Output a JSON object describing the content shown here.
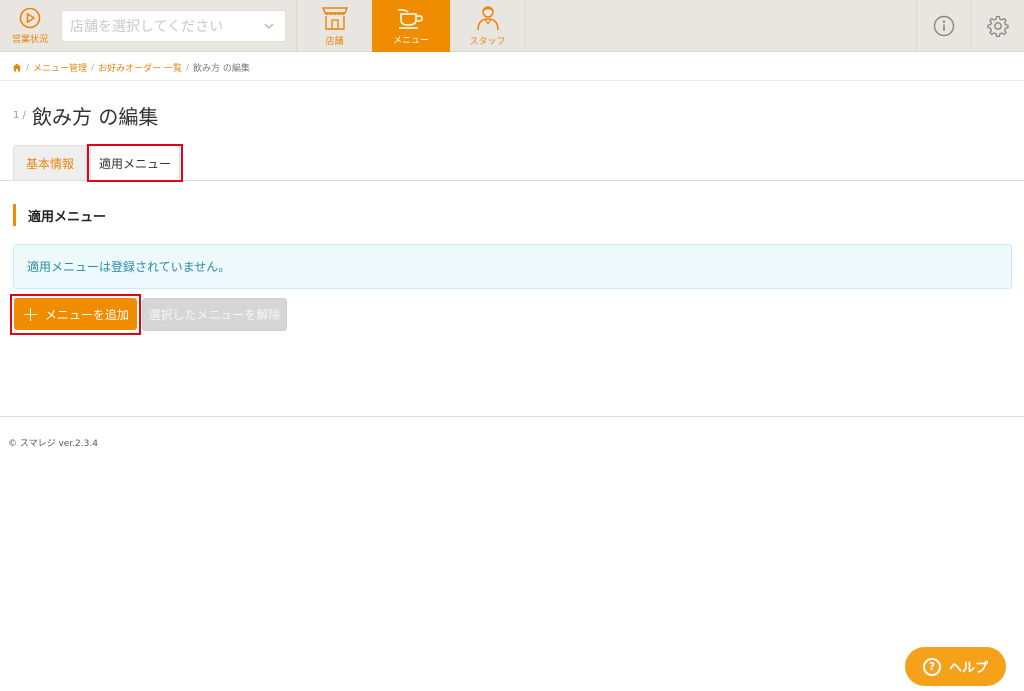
{
  "header": {
    "status_label": "営業状況",
    "store_select": {
      "placeholder": "店舗を選択してください"
    },
    "nav": [
      {
        "label": "店舗",
        "icon": "storefront-icon",
        "active": false
      },
      {
        "label": "メニュー",
        "icon": "coffee-cup-icon",
        "active": true
      },
      {
        "label": "スタッフ",
        "icon": "staff-person-icon",
        "active": false
      }
    ],
    "icons": [
      "info-icon",
      "gear-icon"
    ],
    "accent_color": "#f08c00"
  },
  "breadcrumb": {
    "home_icon": "home-icon",
    "items": [
      "メニュー管理",
      "お好みオーダー 一覧",
      "飲み方 の編集"
    ]
  },
  "page": {
    "title_prefix": "1 /",
    "title": "飲み方 の編集"
  },
  "tabs": [
    {
      "label": "基本情報",
      "active": false
    },
    {
      "label": "適用メニュー",
      "active": true
    }
  ],
  "section": {
    "heading": "適用メニュー",
    "alert_text": "適用メニューは登録されていません。"
  },
  "actions": {
    "add_label": "メニューを追加",
    "remove_label": "選択したメニューを解除"
  },
  "footer": {
    "text": "© スマレジ ver.2.3.4"
  },
  "help": {
    "label": "ヘルプ"
  }
}
